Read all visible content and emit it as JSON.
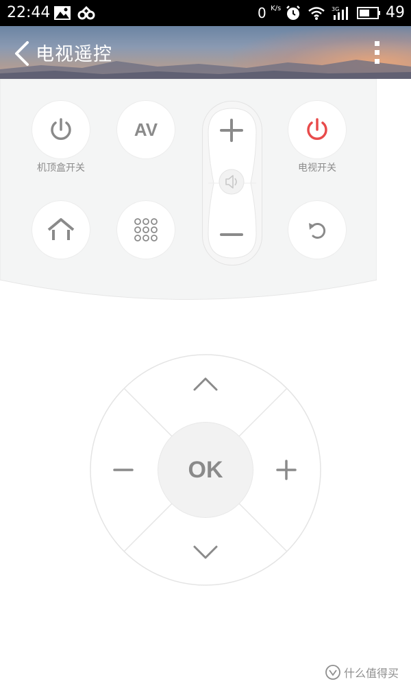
{
  "status_bar": {
    "time": "22:44",
    "speed_value": "0",
    "speed_unit": "K/s",
    "network_label": "3G",
    "battery": "49"
  },
  "header": {
    "title": "电视遥控",
    "back_icon": "chevron-left-icon",
    "more_icon": "more-vertical-icon"
  },
  "remote": {
    "stb_power_label": "机顶盒开关",
    "av_label": "AV",
    "tv_power_label": "电视开关",
    "volume_up": "+",
    "volume_down": "−",
    "ok_label": "OK"
  },
  "colors": {
    "accent_power": "#e84b4b",
    "icon_gray": "#8a8a8a",
    "panel_bg": "#f4f5f5"
  },
  "watermark": {
    "text": "什么值得买"
  }
}
